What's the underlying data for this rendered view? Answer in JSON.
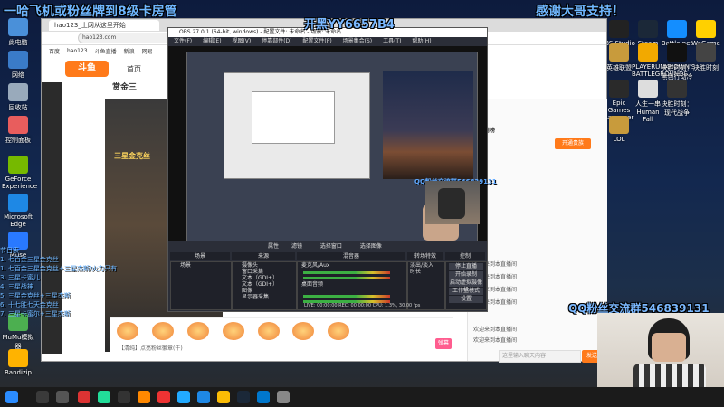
{
  "overlay": {
    "top_left": "一哈飞机或粉丝牌到8级卡房管",
    "top_center": "开黑YY6657B4",
    "top_right": "感谢大哥支持！",
    "qq_group": "QQ粉丝交流群546839131",
    "qq_small": "QQ粉丝交流群546839131",
    "comment_lines": [
      "节目表",
      "1. 七百金三星金克丝",
      "1. 七百金三星金克丝+三星杰斯/火力只有",
      "3. 三星卡蜜儿",
      "4. 三星战神",
      "5. 三星金克丝+三星杰斯",
      "6. 十七胜七天金克丝",
      "7. 三星卡蜜尔+三星杰斯"
    ]
  },
  "desktop": {
    "icons_left": [
      "此电脑",
      "网络",
      "回收站",
      "控制面板",
      "GeForce Experience",
      "Microsoft Edge",
      "Team",
      "Muse",
      "MuMu模拟器",
      "Bandizip"
    ],
    "icons_right": [
      "IBS Studio",
      "Steam",
      "Battle.net",
      "WeGame",
      "英雄联盟",
      "PLAYERUNKNOWN'S BATTLEGROUNDS",
      "决胜时刻：黑色行动冷战",
      "决胜时刻",
      "Epic Games Launcher",
      "人生一串 Human Fall",
      "决胜时刻：现代战争",
      "LOL"
    ]
  },
  "browser": {
    "tab_title": "hao123_上网从这里开始",
    "url": "hao123.com",
    "bookmarks": [
      "百度",
      "hao123",
      "斗鱼直播",
      "新浪",
      "网易"
    ],
    "logo": "斗鱼",
    "home": "首页",
    "stream_title": "赏金三",
    "stream_label": "三星金克丝",
    "chat": {
      "host_btn": "开通贵族",
      "rank_title": "贡献周榜",
      "lines": [
        "欢迎来到本直播间",
        "欢迎来到本直播间",
        "欢迎来到本直播间",
        "欢迎来到本直播间",
        "欢迎来到本直播间",
        "欢迎来到本直播间"
      ],
      "input_placeholder": "这里输入聊天内容",
      "send": "发送"
    },
    "gifts": [
      "鱼丸",
      "火箭",
      "飞机",
      "办卡",
      "超级火箭",
      "告白",
      "奖励"
    ],
    "gift_footer": "【清纯】点亮粉丝徽章(牛)",
    "dan_btn": "弹幕"
  },
  "obs": {
    "title": "OBS 27.0.1 (64-bit, windows) - 配置文件: 未命名 - 场景: 未命名",
    "menu": [
      "文件(F)",
      "编辑(E)",
      "视图(V)",
      "停靠部件(D)",
      "配置文件(P)",
      "场景集合(S)",
      "工具(T)",
      "帮助(H)"
    ],
    "toolbar": [
      "属性",
      "滤镜",
      "选择窗口",
      "选择图像"
    ],
    "panels": {
      "scenes": "场景",
      "sources": "来源",
      "mixer": "混音器",
      "transitions": "转场特效",
      "controls": "控制"
    },
    "scenes": [
      "场景"
    ],
    "sources": [
      "摄像头",
      "窗口采集",
      "文本（GDI+）",
      "文本（GDI+）",
      "图像",
      "显示器采集"
    ],
    "mixer": [
      "麦克风/Aux",
      "桌面音频"
    ],
    "transition": "淡出/淡入",
    "duration_label": "时长",
    "controls": [
      "停止直播",
      "开始录制",
      "启动虚拟摄像机",
      "工作室模式",
      "设置",
      "退出"
    ],
    "status": "LIVE: 00:00:00   REC: 00:00:00   CPU: 1.3%, 30.00 fps"
  }
}
